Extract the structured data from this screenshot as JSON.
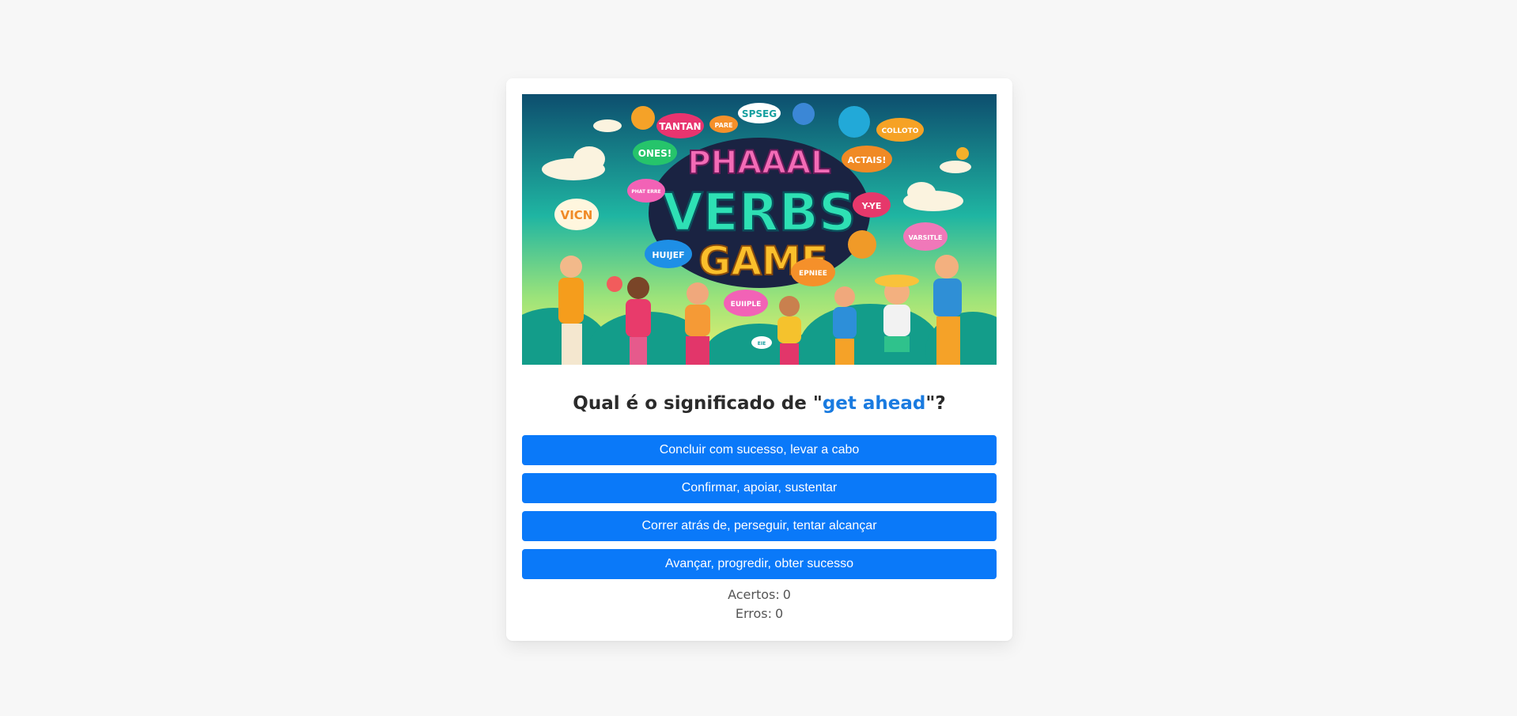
{
  "hero": {
    "title_line1": "PHAAAL",
    "title_line2": "VERBS",
    "title_line3": "GAME",
    "bubbles": [
      "TANTAN",
      "PARE",
      "SPSEG",
      "COLLOTO",
      "ONES!",
      "ACTAIS!",
      "PHAT ERRE",
      "VICN",
      "Y-YE",
      "HUIJEF",
      "VARSITLE",
      "EPNIEE",
      "EUIIPLE",
      "EIE"
    ]
  },
  "question": {
    "prefix": "Qual é o significado de \"",
    "term": "get ahead",
    "suffix": "\"?"
  },
  "options": [
    "Concluir com sucesso, levar a cabo",
    "Confirmar, apoiar, sustentar",
    "Correr atrás de, perseguir, tentar alcançar",
    "Avançar, progredir, obter sucesso"
  ],
  "score": {
    "correct_label": "Acertos:",
    "correct_value": "0",
    "wrong_label": "Erros:",
    "wrong_value": "0"
  },
  "colors": {
    "button": "#0a79f9",
    "highlight": "#1a7be0",
    "background": "#f7f7f7"
  }
}
